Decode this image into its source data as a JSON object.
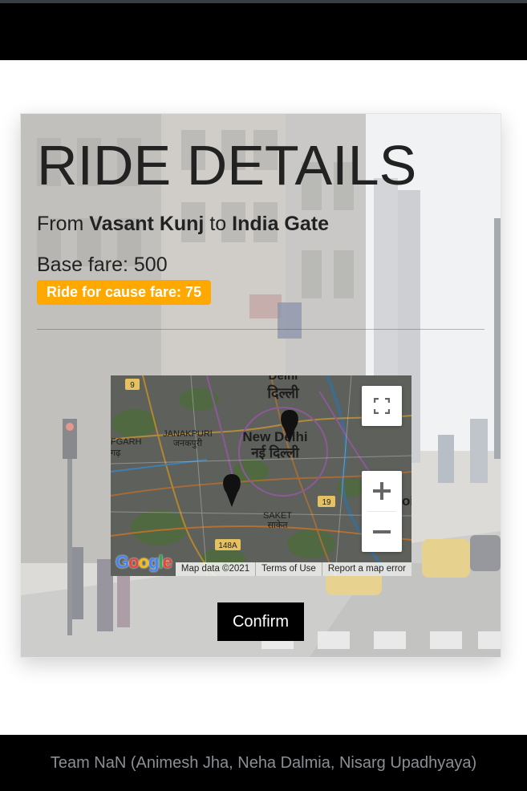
{
  "header": {},
  "ride": {
    "title": "RIDE DETAILS",
    "from_prefix": "From",
    "from": "Vasant Kunj",
    "to_prefix": "to",
    "to": "India Gate",
    "base_fare_text": "Base fare: 500",
    "cause_fare_text": "Ride for cause fare: 75",
    "confirm_label": "Confirm"
  },
  "map": {
    "labels": {
      "delhi_top_en": "Delhi",
      "delhi_top_hi": "दिल्ली",
      "new_delhi_en": "New Delhi",
      "new_delhi_hi": "नई दिल्ली",
      "janakpuri_en": "JANAKPURI",
      "janakpuri_hi": "जनकपुरी",
      "saket_en": "SAKET",
      "saket_hi": "साकेत",
      "fgarh": "FGARH",
      "fgarh_hi": "गढ़",
      "road_9": "9",
      "road_19": "19",
      "road_148a": "148A",
      "edge_oi": "oi"
    },
    "google_logo": "Google",
    "attribution": "Map data ©2021",
    "terms": "Terms of Use",
    "report": "Report a map error",
    "colors": {
      "brand_badge": "#ffa800"
    }
  },
  "footer": {
    "credits": "Team NaN (Animesh Jha, Neha Dalmia, Nisarg Upadhyaya)"
  }
}
